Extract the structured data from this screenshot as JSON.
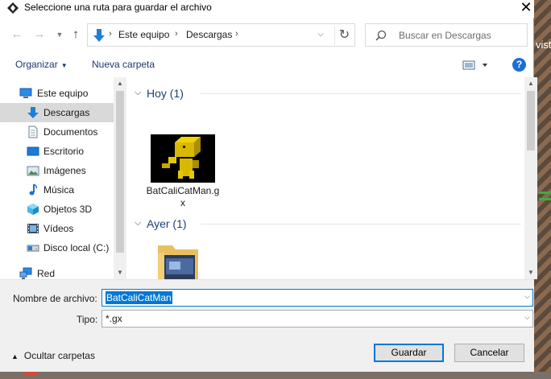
{
  "window": {
    "title": "Seleccione una ruta para guardar el archivo"
  },
  "address": {
    "crumbs": [
      "Este equipo",
      "Descargas"
    ],
    "separator": "›"
  },
  "search": {
    "placeholder": "Buscar en Descargas"
  },
  "toolbar": {
    "organize_label": "Organizar",
    "new_folder_label": "Nueva carpeta",
    "help_label": "?"
  },
  "sidebar": {
    "items": [
      {
        "label": "Este equipo",
        "icon": "computer-icon"
      },
      {
        "label": "Descargas",
        "icon": "download-arrow-icon",
        "selected": true
      },
      {
        "label": "Documentos",
        "icon": "document-icon"
      },
      {
        "label": "Escritorio",
        "icon": "desktop-icon"
      },
      {
        "label": "Imágenes",
        "icon": "pictures-icon"
      },
      {
        "label": "Música",
        "icon": "music-icon"
      },
      {
        "label": "Objetos 3D",
        "icon": "cube-3d-icon"
      },
      {
        "label": "Vídeos",
        "icon": "video-icon"
      },
      {
        "label": "Disco local (C:)",
        "icon": "drive-icon"
      },
      {
        "label": "Red",
        "icon": "network-icon"
      }
    ]
  },
  "groups": [
    {
      "label": "Hoy (1)"
    },
    {
      "label": "Ayer (1)"
    }
  ],
  "files": [
    {
      "name": "BatCaliCatMan.gx"
    }
  ],
  "form": {
    "filename_label": "Nombre de archivo:",
    "filename_value": "BatCaliCatMan",
    "type_label": "Tipo:",
    "type_value": "*.gx"
  },
  "footer": {
    "hide_folders_label": "Ocultar carpetas",
    "save_label": "Guardar",
    "cancel_label": "Cancelar"
  },
  "background": {
    "peek_text": "vist"
  },
  "colors": {
    "accent": "#0078d7",
    "selected_nav": "#d9d9d9",
    "group_header": "#1e3f78"
  }
}
